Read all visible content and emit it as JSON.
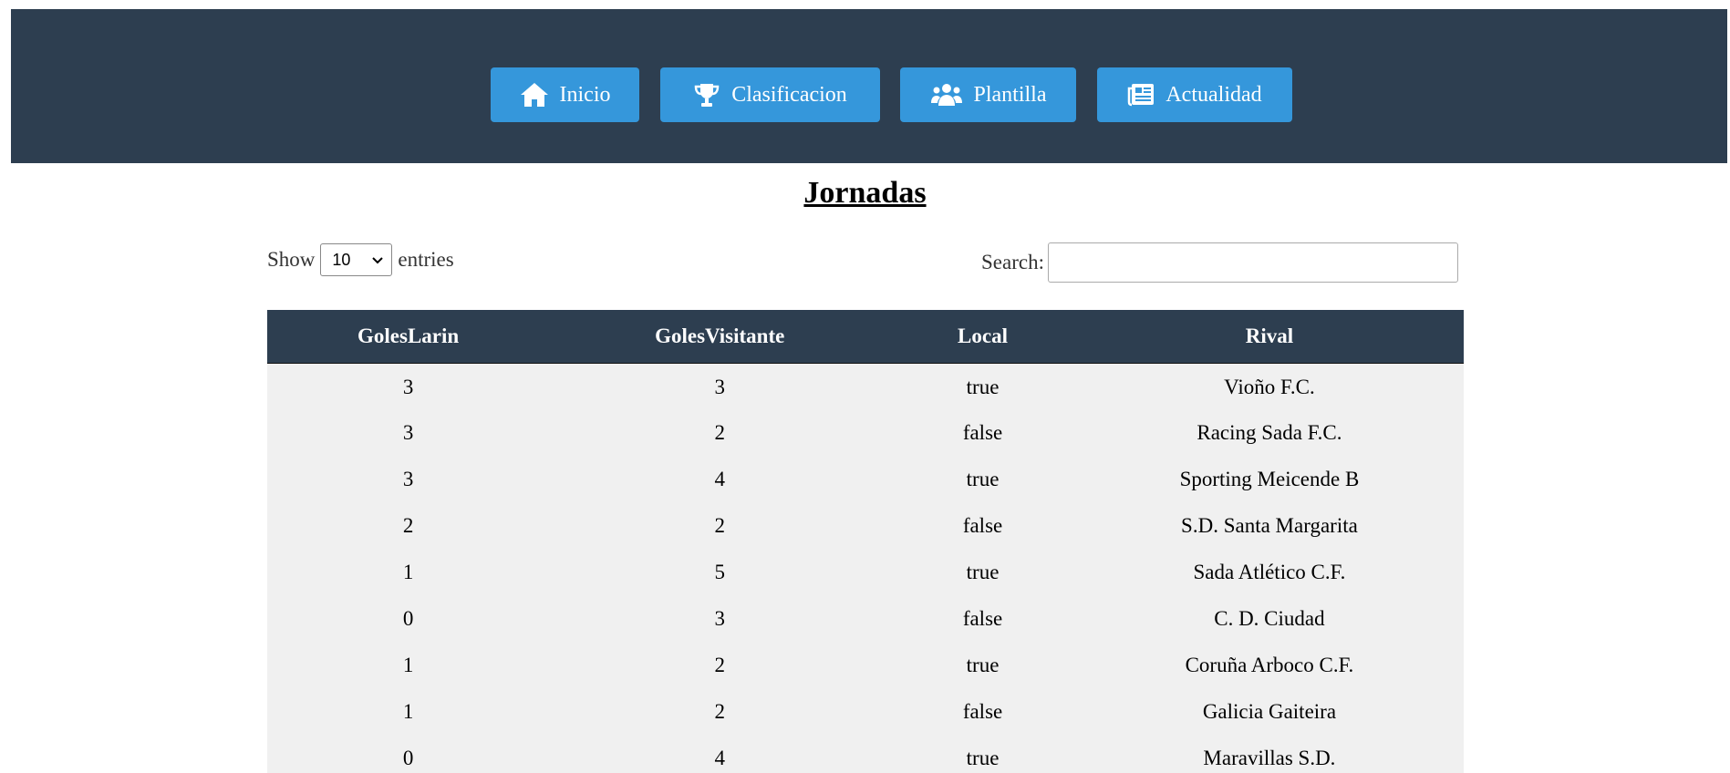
{
  "nav": {
    "items": [
      {
        "label": "Inicio",
        "icon": "home-icon"
      },
      {
        "label": "Clasificacion",
        "icon": "trophy-icon"
      },
      {
        "label": "Plantilla",
        "icon": "users-icon"
      },
      {
        "label": "Actualidad",
        "icon": "newspaper-icon"
      }
    ]
  },
  "page": {
    "title": "Jornadas"
  },
  "controls": {
    "show_label": "Show",
    "entries_value": "10",
    "entries_label": "entries",
    "search_label": "Search:",
    "search_value": ""
  },
  "table": {
    "columns": [
      "GolesLarin",
      "GolesVisitante",
      "Local",
      "Rival"
    ],
    "rows": [
      [
        "3",
        "3",
        "true",
        "Vioño F.C."
      ],
      [
        "3",
        "2",
        "false",
        "Racing Sada F.C."
      ],
      [
        "3",
        "4",
        "true",
        "Sporting Meicende B"
      ],
      [
        "2",
        "2",
        "false",
        "S.D. Santa Margarita"
      ],
      [
        "1",
        "5",
        "true",
        "Sada Atlético C.F."
      ],
      [
        "0",
        "3",
        "false",
        "C. D. Ciudad"
      ],
      [
        "1",
        "2",
        "true",
        "Coruña Arboco C.F."
      ],
      [
        "1",
        "2",
        "false",
        "Galicia Gaiteira"
      ],
      [
        "0",
        "4",
        "true",
        "Maravillas S.D."
      ]
    ]
  },
  "colors": {
    "header_bg": "#2d3e50",
    "button_bg": "#3597db",
    "row_bg": "#f0f0f0"
  }
}
